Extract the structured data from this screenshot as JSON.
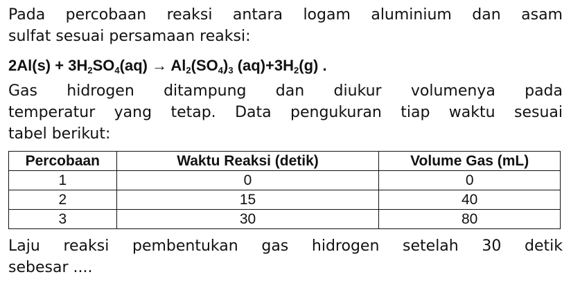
{
  "intro": {
    "line1": "Pada percobaan reaksi antara logam aluminium dan asam",
    "line2": "sulfat sesuai persamaan reaksi:"
  },
  "equation": {
    "coef_al": "2",
    "al": "Al",
    "state_s": "(s)",
    "plus1": "+",
    "coef_h2so4": "3",
    "h": "H",
    "sub_2a": "2",
    "so": "SO",
    "sub_4a": "4",
    "state_aq1": "(aq)",
    "arrow": "→",
    "al2": "Al",
    "sub_2b": "2",
    "paren_open": "(",
    "so_b": "SO",
    "sub_4b": "4",
    "paren_close": ")",
    "sub_3": "3",
    "state_aq2": "(aq)",
    "plus2": "+",
    "coef_h2": "3",
    "h_b": "H",
    "sub_2c": "2",
    "state_g": "(g)",
    "period": "."
  },
  "description": {
    "line1": "Gas hidrogen ditampung dan diukur volumenya pada",
    "line2": "temperatur yang tetap. Data pengukuran tiap waktu sesuai",
    "line3": "tabel berikut:"
  },
  "table": {
    "headers": [
      "Percobaan",
      "Waktu Reaksi (detik)",
      "Volume Gas (mL)"
    ],
    "rows": [
      [
        "1",
        "0",
        "0"
      ],
      [
        "2",
        "15",
        "40"
      ],
      [
        "3",
        "30",
        "80"
      ]
    ]
  },
  "question": {
    "line1": "Laju reaksi pembentukan gas hidrogen setelah 30 detik",
    "line2": "sebesar ...."
  }
}
